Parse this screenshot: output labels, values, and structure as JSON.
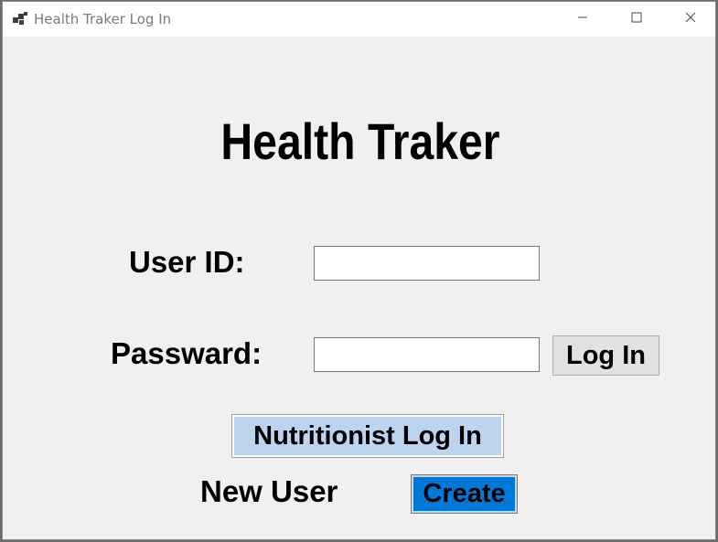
{
  "window": {
    "title": "Health Traker Log In"
  },
  "form": {
    "heading": "Health Traker",
    "user_id_label": "User ID:",
    "password_label": "Passward:",
    "user_id_value": "",
    "password_value": "",
    "login_button": "Log In",
    "nutritionist_button": "Nutritionist Log In",
    "new_user_label": "New User",
    "create_button": "Create"
  },
  "icons": {
    "app": "app-icon",
    "minimize": "minimize-icon",
    "maximize": "maximize-icon",
    "close": "close-icon"
  },
  "colors": {
    "window_bg": "#f0f0f0",
    "nutritionist_button_bg": "#bcd4ee",
    "create_button_bg": "#0078d7"
  }
}
